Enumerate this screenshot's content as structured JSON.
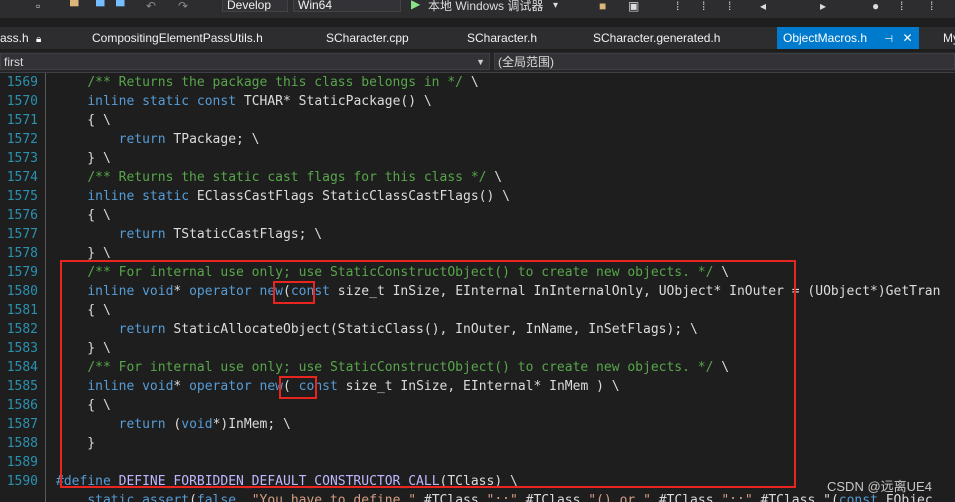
{
  "toolbar": {
    "config": "Develop",
    "platform": "Win64",
    "run_label": "本地 Windows 调试器"
  },
  "tabs": [
    {
      "label": "ass.h",
      "pinned": true
    },
    {
      "label": "CompositingElementPassUtils.h"
    },
    {
      "label": "SCharacter.cpp"
    },
    {
      "label": "SCharacter.h"
    },
    {
      "label": "SCharacter.generated.h"
    },
    {
      "label": "ObjectMacros.h",
      "active": true
    },
    {
      "label": "My"
    }
  ],
  "navbar": {
    "left": "first",
    "right": "(全局范围)"
  },
  "code_lines": [
    {
      "n": "1569",
      "text": "    /** Returns the package this class belongs in */ \\"
    },
    {
      "n": "1570",
      "text": "    inline static const TCHAR* StaticPackage() \\"
    },
    {
      "n": "1571",
      "text": "    { \\"
    },
    {
      "n": "1572",
      "text": "        return TPackage; \\"
    },
    {
      "n": "1573",
      "text": "    } \\"
    },
    {
      "n": "1574",
      "text": "    /** Returns the static cast flags for this class */ \\"
    },
    {
      "n": "1575",
      "text": "    inline static EClassCastFlags StaticClassCastFlags() \\"
    },
    {
      "n": "1576",
      "text": "    { \\"
    },
    {
      "n": "1577",
      "text": "        return TStaticCastFlags; \\"
    },
    {
      "n": "1578",
      "text": "    } \\"
    },
    {
      "n": "1579",
      "text": "    /** For internal use only; use StaticConstructObject() to create new objects. */ \\"
    },
    {
      "n": "1580",
      "text": "    inline void* operator new(const size_t InSize, EInternal InInternalOnly, UObject* InOuter = (UObject*)GetTran"
    },
    {
      "n": "1581",
      "text": "    { \\"
    },
    {
      "n": "1582",
      "text": "        return StaticAllocateObject(StaticClass(), InOuter, InName, InSetFlags); \\"
    },
    {
      "n": "1583",
      "text": "    } \\"
    },
    {
      "n": "1584",
      "text": "    /** For internal use only; use StaticConstructObject() to create new objects. */ \\"
    },
    {
      "n": "1585",
      "text": "    inline void* operator new( const size_t InSize, EInternal* InMem ) \\"
    },
    {
      "n": "1586",
      "text": "    { \\"
    },
    {
      "n": "1587",
      "text": "        return (void*)InMem; \\"
    },
    {
      "n": "1588",
      "text": "    }"
    },
    {
      "n": "1589",
      "text": ""
    },
    {
      "n": "1590",
      "text": "#define DEFINE_FORBIDDEN_DEFAULT_CONSTRUCTOR_CALL(TClass) \\"
    },
    {
      "n": "",
      "text": "    static_assert(false, \"You have to define \" #TClass \"::\" #TClass \"() or \" #TClass \"::\" #TClass \"(const FObjec"
    }
  ],
  "watermark": "CSDN @远离UE4"
}
